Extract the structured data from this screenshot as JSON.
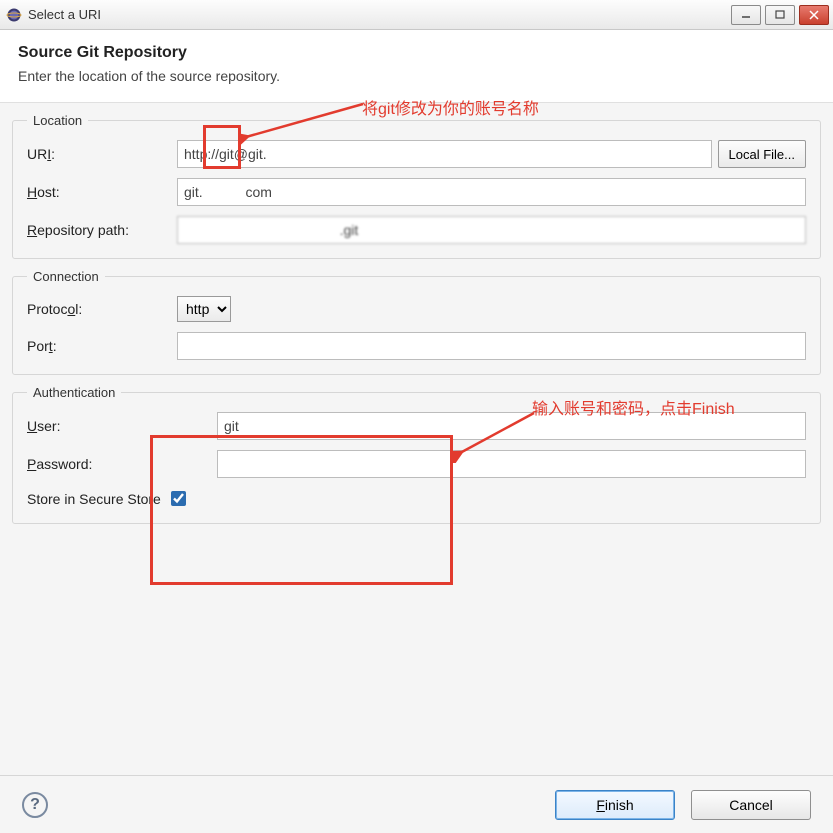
{
  "titlebar": {
    "title": "Select a URI"
  },
  "header": {
    "title": "Source Git Repository",
    "subtitle": "Enter the location of the source repository."
  },
  "location": {
    "legend": "Location",
    "uri_label": "URI:",
    "uri_label_ul": "I",
    "uri_value": "http://git@git.",
    "local_file_btn": "Local File...",
    "host_label": "Host:",
    "host_label_ul": "H",
    "host_value": "git.           com",
    "repo_label": "Repository path:",
    "repo_label_ul": "R",
    "repo_value": "                                        .git"
  },
  "connection": {
    "legend": "Connection",
    "protocol_label": "Protocol:",
    "protocol_label_ul": "o",
    "protocol_value": "http",
    "port_label": "Port:",
    "port_label_ul": "t",
    "port_value": ""
  },
  "auth": {
    "legend": "Authentication",
    "user_label": "User:",
    "user_label_ul": "U",
    "user_value": "git",
    "password_label": "Password:",
    "password_label_ul": "P",
    "password_value": "",
    "store_label": "Store in Secure Store",
    "store_checked": true
  },
  "buttons": {
    "finish": "Finish",
    "finish_ul": "F",
    "cancel": "Cancel"
  },
  "annotations": {
    "top": "将git修改为你的账号名称",
    "right": "输入账号和密码，点击Finish"
  }
}
